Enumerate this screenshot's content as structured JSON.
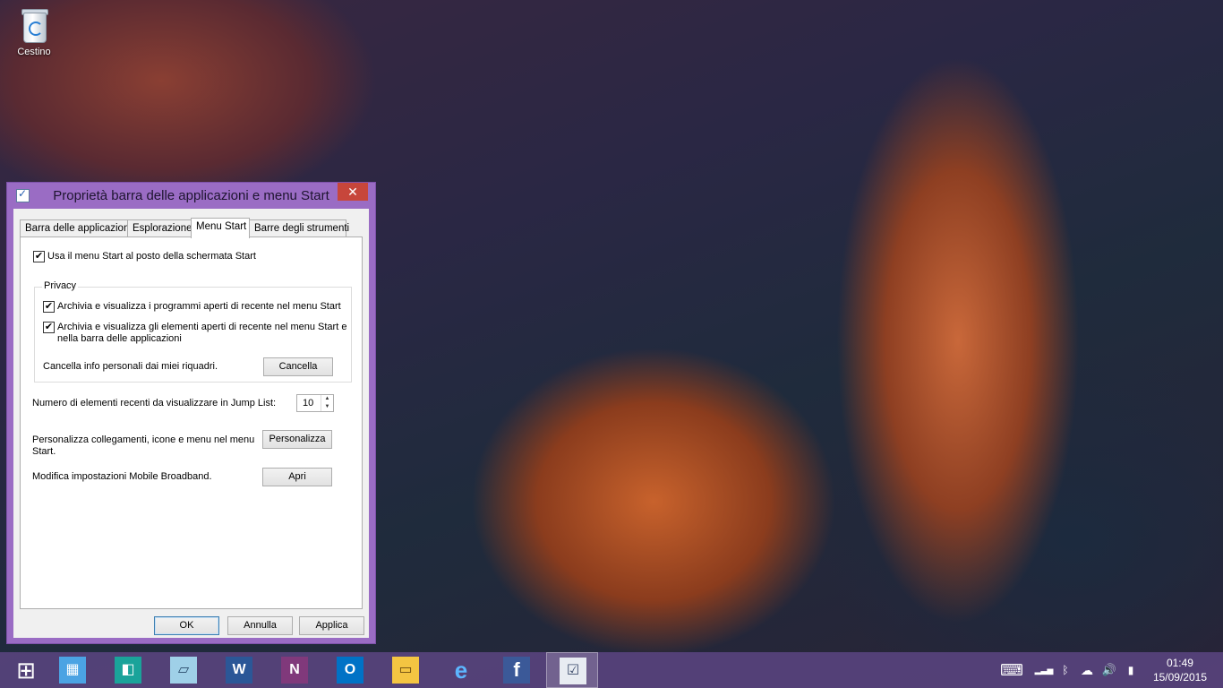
{
  "desktop": {
    "icons": [
      {
        "label": "Cestino",
        "icon": "recycle-bin-icon"
      }
    ]
  },
  "window": {
    "title": "Proprietà barra delle applicazioni e menu Start",
    "close_label": "✕",
    "tabs": [
      "Barra delle applicazioni",
      "Esplorazione",
      "Menu Start",
      "Barre degli strumenti"
    ],
    "active_tab": "Menu Start",
    "use_start_menu": {
      "label": "Usa il menu Start al posto della schermata Start",
      "checked": true
    },
    "privacy": {
      "title": "Privacy",
      "store_programs": {
        "label": "Archivia e visualizza i programmi aperti di recente nel menu Start",
        "checked": true
      },
      "store_items": {
        "line1": "Archivia e visualizza gli elementi aperti di recente nel menu Start e",
        "line2": "nella barra delle applicazioni",
        "checked": true
      },
      "clear_label": "Cancella info personali dai miei riquadri.",
      "clear_button": "Cancella"
    },
    "jump_list": {
      "label": "Numero di elementi recenti da visualizzare in Jump List:",
      "value": "10"
    },
    "customize": {
      "line1": "Personalizza collegamenti, icone e menu nel menu",
      "line2": "Start.",
      "button": "Personalizza"
    },
    "broadband": {
      "label": "Modifica impostazioni Mobile Broadband.",
      "button": "Apri"
    },
    "footer": {
      "ok": "OK",
      "cancel": "Annulla",
      "apply": "Applica"
    }
  },
  "taskbar": {
    "items": [
      {
        "name": "start-button",
        "glyph": "⊞",
        "color": "#ffffff"
      },
      {
        "name": "control-panel-icon",
        "glyph": "▦",
        "color": "#4ba3e3"
      },
      {
        "name": "sway-icon",
        "glyph": "◧",
        "color": "#1aa39a"
      },
      {
        "name": "notepad-icon",
        "glyph": "▱",
        "color": "#9fd0e8"
      },
      {
        "name": "word-icon",
        "glyph": "W",
        "color": "#2b5797"
      },
      {
        "name": "onenote-icon",
        "glyph": "N",
        "color": "#80397b"
      },
      {
        "name": "outlook-icon",
        "glyph": "O",
        "color": "#0072c6"
      },
      {
        "name": "file-explorer-icon",
        "glyph": "▭",
        "color": "#f4c542"
      },
      {
        "name": "internet-explorer-icon",
        "glyph": "e",
        "color": "#1e90ff"
      },
      {
        "name": "facebook-icon",
        "glyph": "f",
        "color": "#3b5998"
      },
      {
        "name": "taskbar-properties-icon",
        "glyph": "☑",
        "color": "#3a4a6a"
      }
    ],
    "tray": {
      "keyboard": "⌨",
      "signal": "▂▃▅",
      "bluetooth": "ᛒ",
      "onedrive": "☁",
      "volume": "🔊",
      "power": "▮"
    },
    "time": "01:49",
    "date": "15/09/2015"
  }
}
